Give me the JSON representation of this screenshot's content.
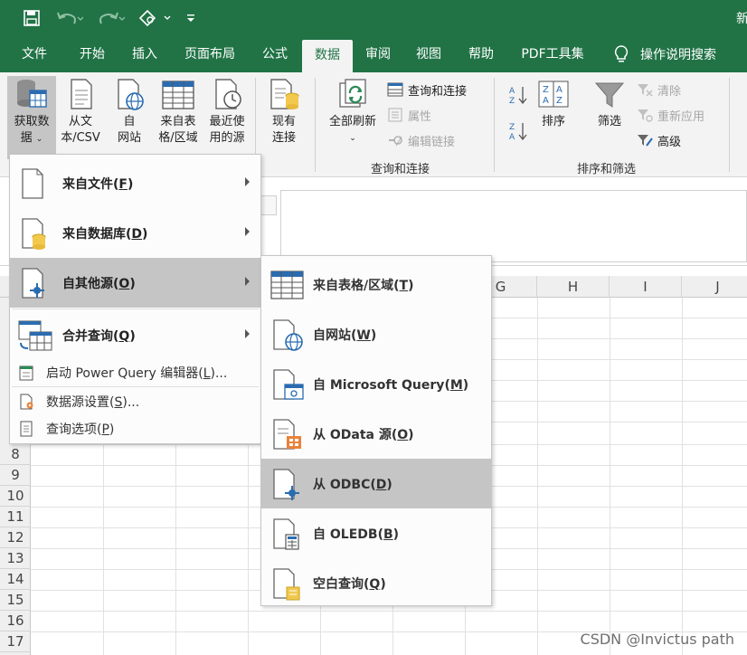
{
  "window": {
    "title": "新"
  },
  "qat": {
    "save": "save-icon",
    "undo": "undo-icon",
    "redo": "redo-icon",
    "touch": "touch-mode-icon",
    "customize": "customize-qat-icon"
  },
  "tabs": [
    {
      "label": "文件"
    },
    {
      "label": "开始"
    },
    {
      "label": "插入"
    },
    {
      "label": "页面布局"
    },
    {
      "label": "公式"
    },
    {
      "label": "数据"
    },
    {
      "label": "审阅"
    },
    {
      "label": "视图"
    },
    {
      "label": "帮助"
    },
    {
      "label": "PDF工具集"
    }
  ],
  "tell_me": {
    "label": "操作说明搜索"
  },
  "ribbon": {
    "get_data": {
      "line1": "获取数",
      "line2": "据"
    },
    "from_text": {
      "line1": "从文",
      "line2": "本/CSV"
    },
    "from_web": {
      "line1": "自",
      "line2": "网站"
    },
    "from_table": {
      "line1": "来自表",
      "line2": "格/区域"
    },
    "recent": {
      "line1": "最近使",
      "line2": "用的源"
    },
    "existing": {
      "line1": "现有",
      "line2": "连接"
    },
    "refresh_all": {
      "line1": "全部刷新"
    },
    "queries_connections": "查询和连接",
    "properties": "属性",
    "edit_links": "编辑链接",
    "group_queries": "查询和连接",
    "sort": "排序",
    "filter": "筛选",
    "clear": "清除",
    "reapply": "重新应用",
    "advanced": "高级",
    "group_sort": "排序和筛选"
  },
  "columns": [
    "G",
    "H",
    "I",
    "J"
  ],
  "rows": [
    "8",
    "9",
    "10",
    "11",
    "12",
    "13",
    "14",
    "15",
    "16",
    "17"
  ],
  "menu_get_data": {
    "items": [
      {
        "label": "来自文件",
        "key": "F"
      },
      {
        "label": "来自数据库",
        "key": "D"
      },
      {
        "label": "自其他源",
        "key": "O"
      },
      {
        "label": "合并查询",
        "key": "Q"
      }
    ],
    "launch_pq": {
      "label": "启动 Power Query 编辑器",
      "key": "L",
      "suffix": "..."
    },
    "ds_settings": {
      "label": "数据源设置",
      "key": "S",
      "suffix": "..."
    },
    "query_options": {
      "label": "查询选项",
      "key": "P"
    }
  },
  "menu_other_sources": {
    "items": [
      {
        "label": "来自表格/区域",
        "key": "T"
      },
      {
        "label": "自网站",
        "key": "W"
      },
      {
        "label": "自 Microsoft Query",
        "key": "M"
      },
      {
        "label": "从 OData 源",
        "key": "O"
      },
      {
        "label": "从 ODBC",
        "key": "D"
      },
      {
        "label": "自 OLEDB",
        "key": "B"
      },
      {
        "label": "空白查询",
        "key": "Q"
      }
    ]
  },
  "watermark": "CSDN @Invictus path",
  "colors": {
    "excel_green": "#217346",
    "hover_gray": "#c5c5c5",
    "accent_blue": "#2b6cb0",
    "db_yellow": "#f2c94c"
  }
}
